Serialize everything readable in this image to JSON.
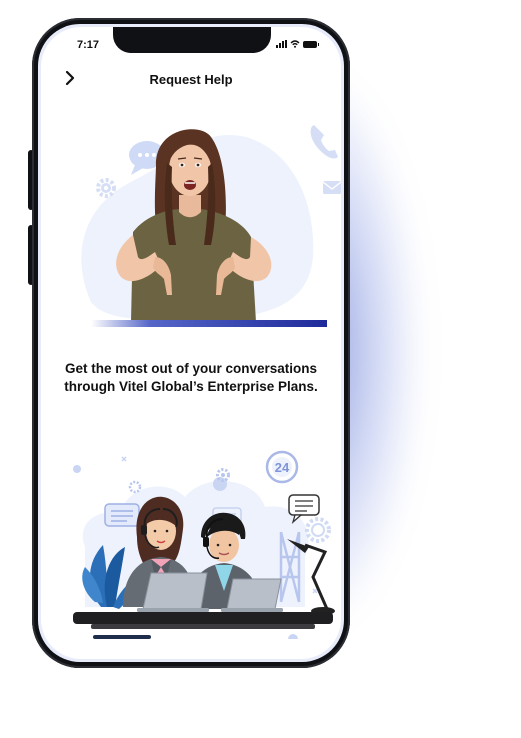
{
  "status_bar": {
    "time": "7:17"
  },
  "header": {
    "title": "Request Help",
    "back_icon": "chevron-right-icon"
  },
  "content": {
    "headline_line1": "Get the most out of your conversations",
    "headline_line2": "through Vitel Global’s Enterprise Plans."
  },
  "illustration": {
    "badge": "24"
  },
  "colors": {
    "accent": "#1e2a9a",
    "accent_light": "#dfe6fb",
    "frame": "#0f1115"
  }
}
